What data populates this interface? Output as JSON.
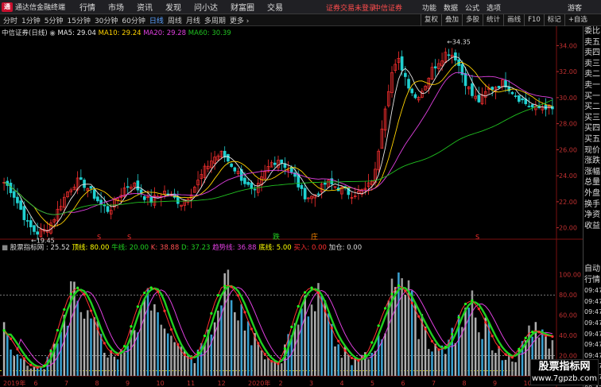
{
  "app": {
    "logo": "通",
    "title": "通达信金融终端"
  },
  "menu": [
    "行情",
    "市场",
    "资讯",
    "发现",
    "问小达",
    "财富圈",
    "交易"
  ],
  "titlebar": {
    "warning": "证券交易未登录",
    "broker": "中信证券",
    "right_items": [
      "功能",
      "数据",
      "公式",
      "选项"
    ],
    "user": "游客"
  },
  "periods": [
    "分时",
    "1分钟",
    "5分钟",
    "15分钟",
    "30分钟",
    "60分钟",
    "日线",
    "周线",
    "月线",
    "多周期",
    "更多 ›"
  ],
  "active_period": 6,
  "toolbar_buttons": [
    "复权",
    "叠加",
    "多股",
    "统计",
    "画线",
    "F10",
    "标记",
    "+自选"
  ],
  "stock_title": "中信证券(日线)",
  "ma": [
    {
      "label": "MA5: 29.04",
      "color": "#e8e8e8"
    },
    {
      "label": "MA10: 29.24",
      "color": "#ffd200"
    },
    {
      "label": "MA20: 29.28",
      "color": "#e040e0"
    },
    {
      "label": "MA60: 30.39",
      "color": "#20c020"
    }
  ],
  "price_axis": [
    "34.00",
    "32.00",
    "30.00",
    "28.00",
    "26.00",
    "24.00",
    "22.00",
    "20.00"
  ],
  "indicator_axis": [
    "100.00",
    "80.00",
    "60.00",
    "40.00",
    "20.00"
  ],
  "high_label": "34.35",
  "low_label": "19.45",
  "signals": [
    {
      "text": "跌",
      "color": "#20d020"
    },
    {
      "text": "庄",
      "color": "#ff8a00"
    }
  ],
  "indicator_legend": [
    {
      "label": "股票指标网 : 25.52",
      "color": "#dddddd"
    },
    {
      "label": "顶线: 80.00",
      "color": "#ffff00"
    },
    {
      "label": "牛线: 20.00",
      "color": "#20d020"
    },
    {
      "label": "K: 38.88",
      "color": "#ff5050"
    },
    {
      "label": "D: 37.23",
      "color": "#20d020"
    },
    {
      "label": "趋势线: 36.88",
      "color": "#e040e0"
    },
    {
      "label": "底线: 5.00",
      "color": "#ffff00"
    },
    {
      "label": "买入: 0.00",
      "color": "#ff3030"
    },
    {
      "label": "加仓: 0.00",
      "color": "#dddddd"
    }
  ],
  "time_axis": [
    "2019年",
    "6",
    "7",
    "8",
    "9",
    "10",
    "11",
    "12",
    "2020年",
    "2",
    "3",
    "4",
    "5",
    "6",
    "7",
    "8",
    "9",
    "10"
  ],
  "sidebar_red": "L\nR",
  "sidebar_items": [
    "委比",
    "卖五",
    "卖四",
    "卖三",
    "卖二",
    "卖一",
    "买一",
    "买二",
    "买三",
    "买四",
    "买五",
    "现价",
    "涨跌",
    "涨幅",
    "总量",
    "外盘",
    "换手",
    "净资",
    "收益",
    "",
    "",
    "",
    "自动",
    "行情",
    "09:47",
    "09:47",
    "09:47",
    "09:47",
    "09:47",
    "09:47",
    "09:47",
    "09:47",
    "09:47",
    "09:47",
    "09:47"
  ],
  "watermark": {
    "title": "股票指标网",
    "url": "www.7gpzb.com"
  },
  "chart_data": {
    "type": "candlestick",
    "series": [
      {
        "name": "MA5",
        "last": 29.04
      },
      {
        "name": "MA10",
        "last": 29.24
      },
      {
        "name": "MA20",
        "last": 29.28
      },
      {
        "name": "MA60",
        "last": 30.39
      }
    ],
    "ylim": [
      19,
      35
    ],
    "high": 34.35,
    "low": 19.45,
    "close_path": [
      23.5,
      22.8,
      21.5,
      20.2,
      19.6,
      19.8,
      20.5,
      21.8,
      22.9,
      23.6,
      23.3,
      22.6,
      21.8,
      21.3,
      22.2,
      23.1,
      23.4,
      22.7,
      22.0,
      22.4,
      22.8,
      22.3,
      21.9,
      22.6,
      23.5,
      24.6,
      25.4,
      25.7,
      25.0,
      24.2,
      23.4,
      22.5,
      23.8,
      24.9,
      25.3,
      24.7,
      23.9,
      22.6,
      22.3,
      22.8,
      23.5,
      23.2,
      22.9,
      22.6,
      22.7,
      23.0,
      24.2,
      28.5,
      31.8,
      32.9,
      31.2,
      30.0,
      30.7,
      32.1,
      32.9,
      33.6,
      33.1,
      31.5,
      30.2,
      29.7,
      30.6,
      30.9,
      31.2,
      30.5,
      29.9,
      29.4,
      29.1,
      29.4,
      29.04
    ],
    "indicator": {
      "ylim": [
        0,
        110
      ],
      "top_line": 80,
      "bull_line": 20,
      "bottom_line": 5,
      "last": {
        "K": 38.88,
        "D": 37.23,
        "trend": 36.88,
        "value": 25.52
      },
      "k_path": [
        45,
        35,
        22,
        12,
        8,
        10,
        28,
        55,
        78,
        88,
        80,
        60,
        38,
        25,
        20,
        30,
        55,
        78,
        88,
        85,
        62,
        40,
        24,
        16,
        22,
        42,
        70,
        88,
        90,
        80,
        60,
        40,
        25,
        15,
        12,
        30,
        58,
        80,
        88,
        82,
        60,
        40,
        28,
        18,
        15,
        22,
        40,
        62,
        80,
        90,
        82,
        65,
        50,
        35,
        25,
        30,
        50,
        70,
        75,
        65,
        48,
        32,
        22,
        18,
        28,
        42,
        45,
        40,
        38.88
      ]
    }
  }
}
